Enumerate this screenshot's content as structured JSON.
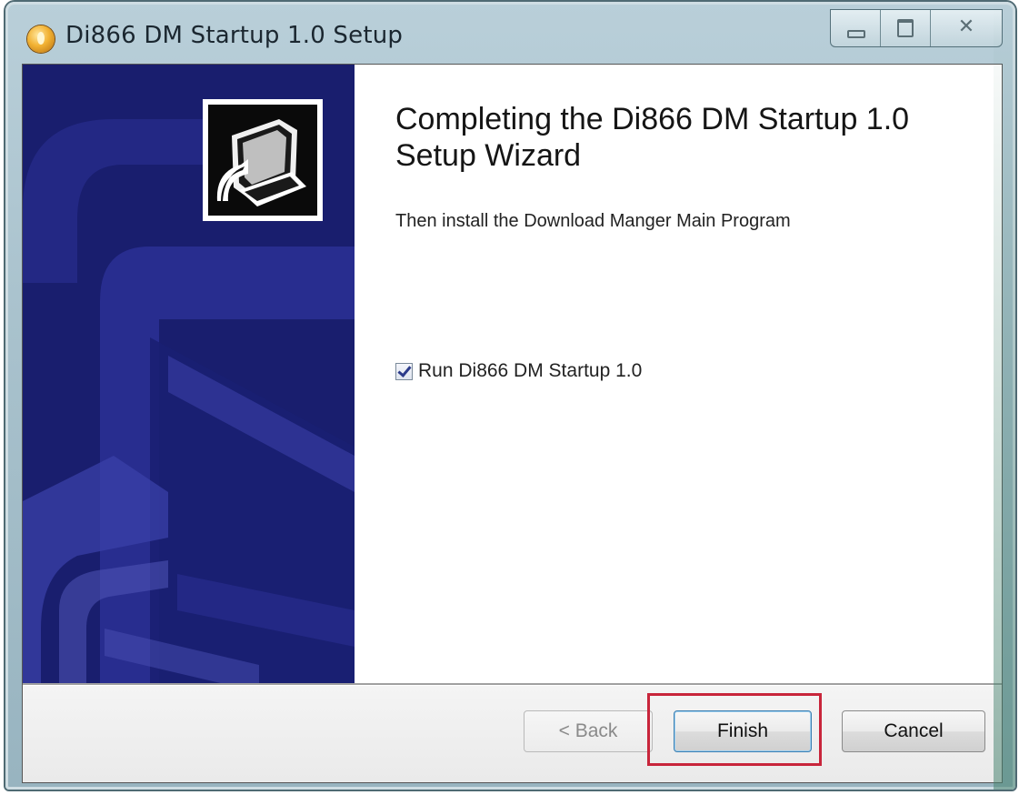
{
  "window": {
    "title": "Di866 DM Startup 1.0 Setup",
    "caption_close_glyph": "✕"
  },
  "main": {
    "heading": "Completing the Di866 DM Startup 1.0 Setup Wizard",
    "subtext": "Then install the Download Manger Main Program",
    "checkbox": {
      "label": "Run Di866 DM Startup 1.0",
      "checked": true
    }
  },
  "buttons": {
    "back_label": "< Back",
    "finish_label": "Finish",
    "cancel_label": "Cancel"
  },
  "colors": {
    "side_panel": "#1e2380",
    "highlight": "#c8253b"
  },
  "icons": {
    "title": "setup-app-icon",
    "wizard": "installer-computer-icon"
  }
}
